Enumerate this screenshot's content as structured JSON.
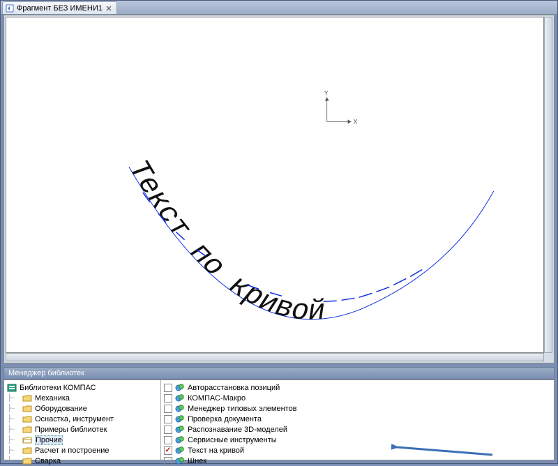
{
  "tab": {
    "title": "Фрагмент БЕЗ ИМЕНИ1"
  },
  "axes": {
    "x": "X",
    "y": "Y"
  },
  "drawing": {
    "curve_text": "Текст по кривой"
  },
  "library_manager_title": "Менеджер библиотек",
  "tree": {
    "root_label": "Библиотеки КОМПАС",
    "items": [
      "Механика",
      "Оборудование",
      "Оснастка, инструмент",
      "Примеры библиотек",
      "Прочие",
      "Расчет и построение",
      "Сварка"
    ],
    "selected_index": 4
  },
  "list": {
    "items": [
      {
        "label": "Авторасстановка позиций",
        "checked": false
      },
      {
        "label": "КОМПАС-Макро",
        "checked": false
      },
      {
        "label": "Менеджер типовых элементов",
        "checked": false
      },
      {
        "label": "Проверка документа",
        "checked": false
      },
      {
        "label": "Распознавание 3D-моделей",
        "checked": false
      },
      {
        "label": "Сервисные инструменты",
        "checked": false
      },
      {
        "label": "Текст на кривой",
        "checked": true
      },
      {
        "label": "Шнек",
        "checked": false
      }
    ]
  }
}
